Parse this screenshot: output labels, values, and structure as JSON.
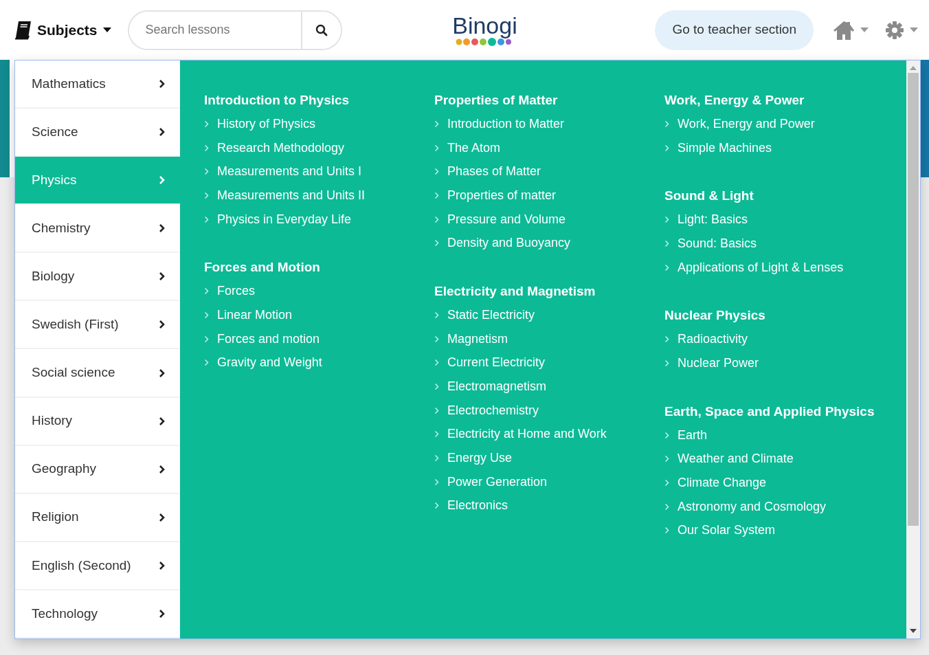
{
  "header": {
    "subjects_label": "Subjects",
    "search": {
      "placeholder": "Search lessons"
    },
    "logo": "Binogi",
    "teacher_button": "Go to teacher section"
  },
  "sidebar": {
    "items": [
      {
        "label": "Mathematics",
        "selected": false
      },
      {
        "label": "Science",
        "selected": false
      },
      {
        "label": "Physics",
        "selected": true
      },
      {
        "label": "Chemistry",
        "selected": false
      },
      {
        "label": "Biology",
        "selected": false
      },
      {
        "label": "Swedish (First)",
        "selected": false
      },
      {
        "label": "Social science",
        "selected": false
      },
      {
        "label": "History",
        "selected": false
      },
      {
        "label": "Geography",
        "selected": false
      },
      {
        "label": "Religion",
        "selected": false
      },
      {
        "label": "English (Second)",
        "selected": false
      },
      {
        "label": "Technology",
        "selected": false
      }
    ]
  },
  "columns": [
    [
      {
        "title": "Introduction to Physics",
        "links": [
          "History of Physics",
          "Research Methodology",
          "Measurements and Units I",
          "Measurements and Units II",
          "Physics in Everyday Life"
        ]
      },
      {
        "title": "Forces and Motion",
        "links": [
          "Forces",
          "Linear Motion",
          "Forces and motion",
          "Gravity and Weight"
        ]
      }
    ],
    [
      {
        "title": "Properties of Matter",
        "links": [
          "Introduction to Matter",
          "The Atom",
          "Phases of Matter",
          "Properties of matter",
          "Pressure and Volume",
          "Density and Buoyancy"
        ]
      },
      {
        "title": "Electricity and Magnetism",
        "links": [
          "Static Electricity",
          "Magnetism",
          "Current Electricity",
          "Electromagnetism",
          "Electrochemistry",
          "Electricity at Home and Work",
          "Energy Use",
          "Power Generation",
          "Electronics"
        ]
      }
    ],
    [
      {
        "title": "Work, Energy & Power",
        "links": [
          "Work, Energy and Power",
          "Simple Machines"
        ]
      },
      {
        "title": "Sound & Light",
        "links": [
          "Light: Basics",
          "Sound: Basics",
          "Applications of Light & Lenses"
        ]
      },
      {
        "title": "Nuclear Physics",
        "links": [
          "Radioactivity",
          "Nuclear Power"
        ]
      },
      {
        "title": "Earth, Space and Applied Physics",
        "links": [
          "Earth",
          "Weather and Climate",
          "Climate Change",
          "Astronomy and Cosmology",
          "Our Solar System"
        ]
      }
    ]
  ]
}
